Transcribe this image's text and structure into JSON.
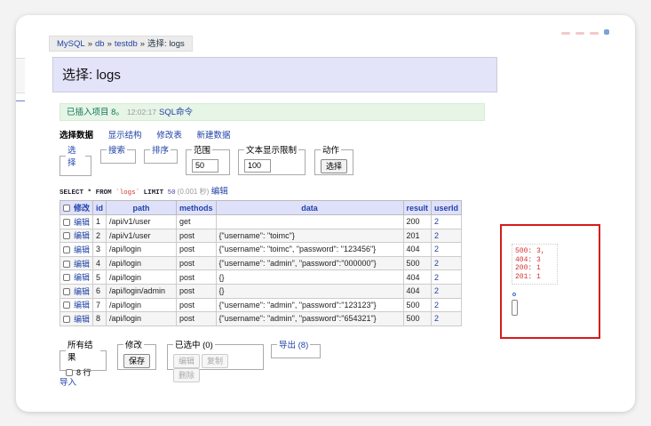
{
  "breadcrumb": {
    "items": [
      "MySQL",
      "db",
      "testdb"
    ],
    "separator": "»",
    "current": "选择: logs"
  },
  "title": "选择: logs",
  "notice": {
    "message": "已插入项目 8。",
    "time": "12:02:17",
    "sql_link": "SQL命令"
  },
  "tabs": [
    "选择数据",
    "显示结构",
    "修改表",
    "新建数据"
  ],
  "filters": {
    "select": "选择",
    "search": "搜索",
    "sort": "排序",
    "range_label": "范围",
    "range_value": "50",
    "text_limit_label": "文本显示限制",
    "text_limit_value": "100",
    "action_label": "动作",
    "action_button": "选择"
  },
  "query": {
    "keyword_select": "SELECT",
    "star": "*",
    "keyword_from": "FROM",
    "table": "`logs`",
    "keyword_limit": "LIMIT",
    "limit": "50",
    "duration": "(0.001 秒)",
    "edit_link": "编辑"
  },
  "table": {
    "headers": [
      "修改",
      "id",
      "path",
      "methods",
      "data",
      "result",
      "userId"
    ],
    "edit_label": "编辑",
    "rows": [
      {
        "id": "1",
        "path": "/api/v1/user",
        "method": "get",
        "data": "",
        "result": "200",
        "userId": "2"
      },
      {
        "id": "2",
        "path": "/api/v1/user",
        "method": "post",
        "data": "{\"username\": \"toimc\"}",
        "result": "201",
        "userId": "2"
      },
      {
        "id": "3",
        "path": "/api/login",
        "method": "post",
        "data": "{\"username\": \"toimc\", \"password\": \"123456\"}",
        "result": "404",
        "userId": "2"
      },
      {
        "id": "4",
        "path": "/api/login",
        "method": "post",
        "data": "{\"username\": \"admin\", \"password\":\"000000\"}",
        "result": "500",
        "userId": "2"
      },
      {
        "id": "5",
        "path": "/api/login",
        "method": "post",
        "data": "{}",
        "result": "404",
        "userId": "2"
      },
      {
        "id": "6",
        "path": "/api/login/admin",
        "method": "post",
        "data": "{}",
        "result": "404",
        "userId": "2"
      },
      {
        "id": "7",
        "path": "/api/login",
        "method": "post",
        "data": "{\"username\": \"admin\", \"password\":\"123123\"}",
        "result": "500",
        "userId": "2"
      },
      {
        "id": "8",
        "path": "/api/login",
        "method": "post",
        "data": "{\"username\": \"admin\", \"password\":\"654321\"}",
        "result": "500",
        "userId": "2"
      }
    ]
  },
  "footer": {
    "all_results_label": "所有结果",
    "all_results_value": "8 行",
    "modify_label": "修改",
    "save_button": "保存",
    "selected_label": "已选中 (0)",
    "edit_button": "编辑",
    "copy_button": "复制",
    "delete_button": "删除",
    "export_link": "导出 (8)",
    "import_link": "导入"
  },
  "result_summary": {
    "lines": [
      "500: 3,",
      "404: 3",
      "200: 1",
      "201: 1"
    ]
  },
  "colors": {
    "link": "#2243a6",
    "title_bg": "#e3e3fa",
    "notice_bg": "#e6f5e6",
    "highlight_border": "#d61c1c",
    "summary_text": "#d43030"
  }
}
